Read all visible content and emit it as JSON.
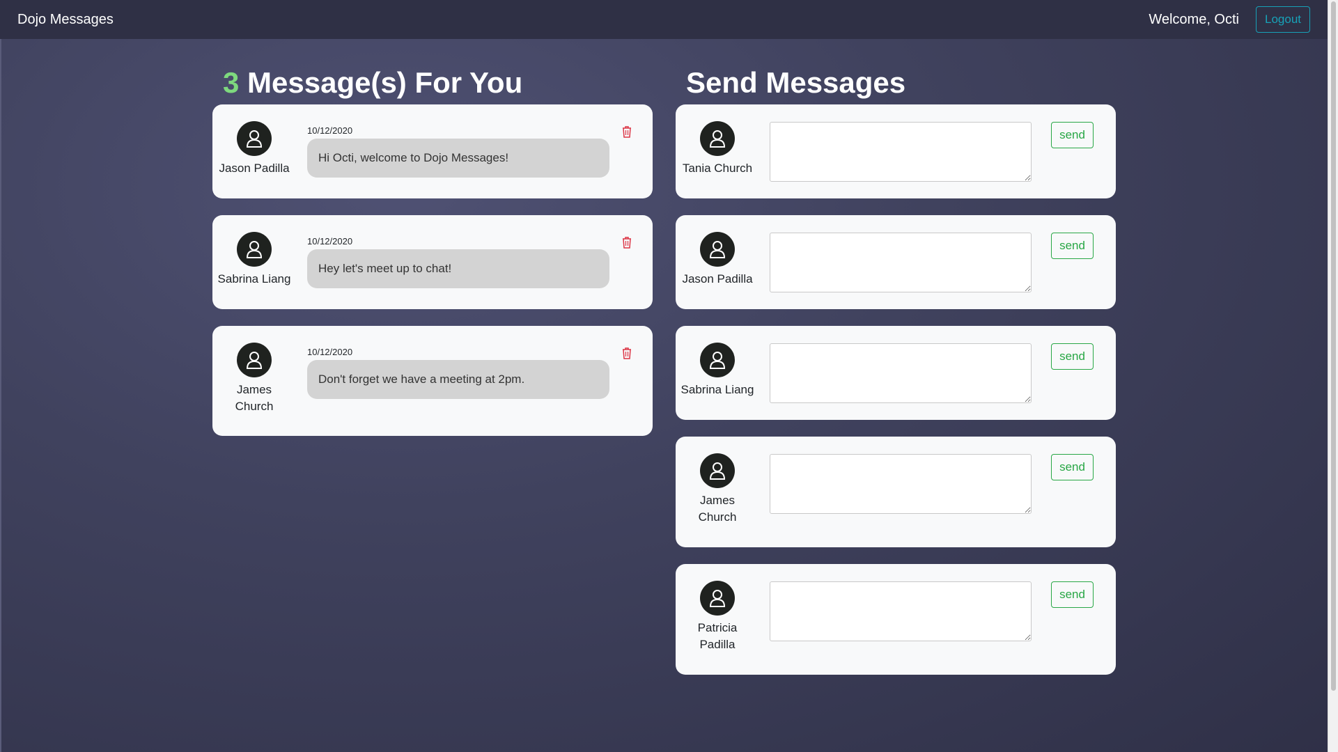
{
  "navbar": {
    "brand": "Dojo Messages",
    "welcome": "Welcome, Octi",
    "logout_label": "Logout"
  },
  "inbox": {
    "count": "3",
    "title_suffix": " Message(s) For You",
    "messages": [
      {
        "sender": "Jason Padilla",
        "date": "10/12/2020",
        "text": "Hi Octi, welcome to Dojo Messages!"
      },
      {
        "sender": "Sabrina Liang",
        "date": "10/12/2020",
        "text": "Hey let's meet up to chat!"
      },
      {
        "sender": "James Church",
        "date": "10/12/2020",
        "text": "Don't forget we have a meeting at 2pm."
      }
    ]
  },
  "send": {
    "title": "Send Messages",
    "send_label": "send",
    "recipients": [
      {
        "name": "Tania Church",
        "value": ""
      },
      {
        "name": "Jason Padilla",
        "value": ""
      },
      {
        "name": "Sabrina Liang",
        "value": ""
      },
      {
        "name": "James Church",
        "value": ""
      },
      {
        "name": "Patricia Padilla",
        "value": ""
      }
    ]
  },
  "colors": {
    "accent_count": "#7ed97e",
    "logout": "#17a2b8",
    "send": "#28a745",
    "trash": "#dc3545"
  },
  "icons": {
    "avatar": "person-icon",
    "delete": "trash-icon"
  }
}
